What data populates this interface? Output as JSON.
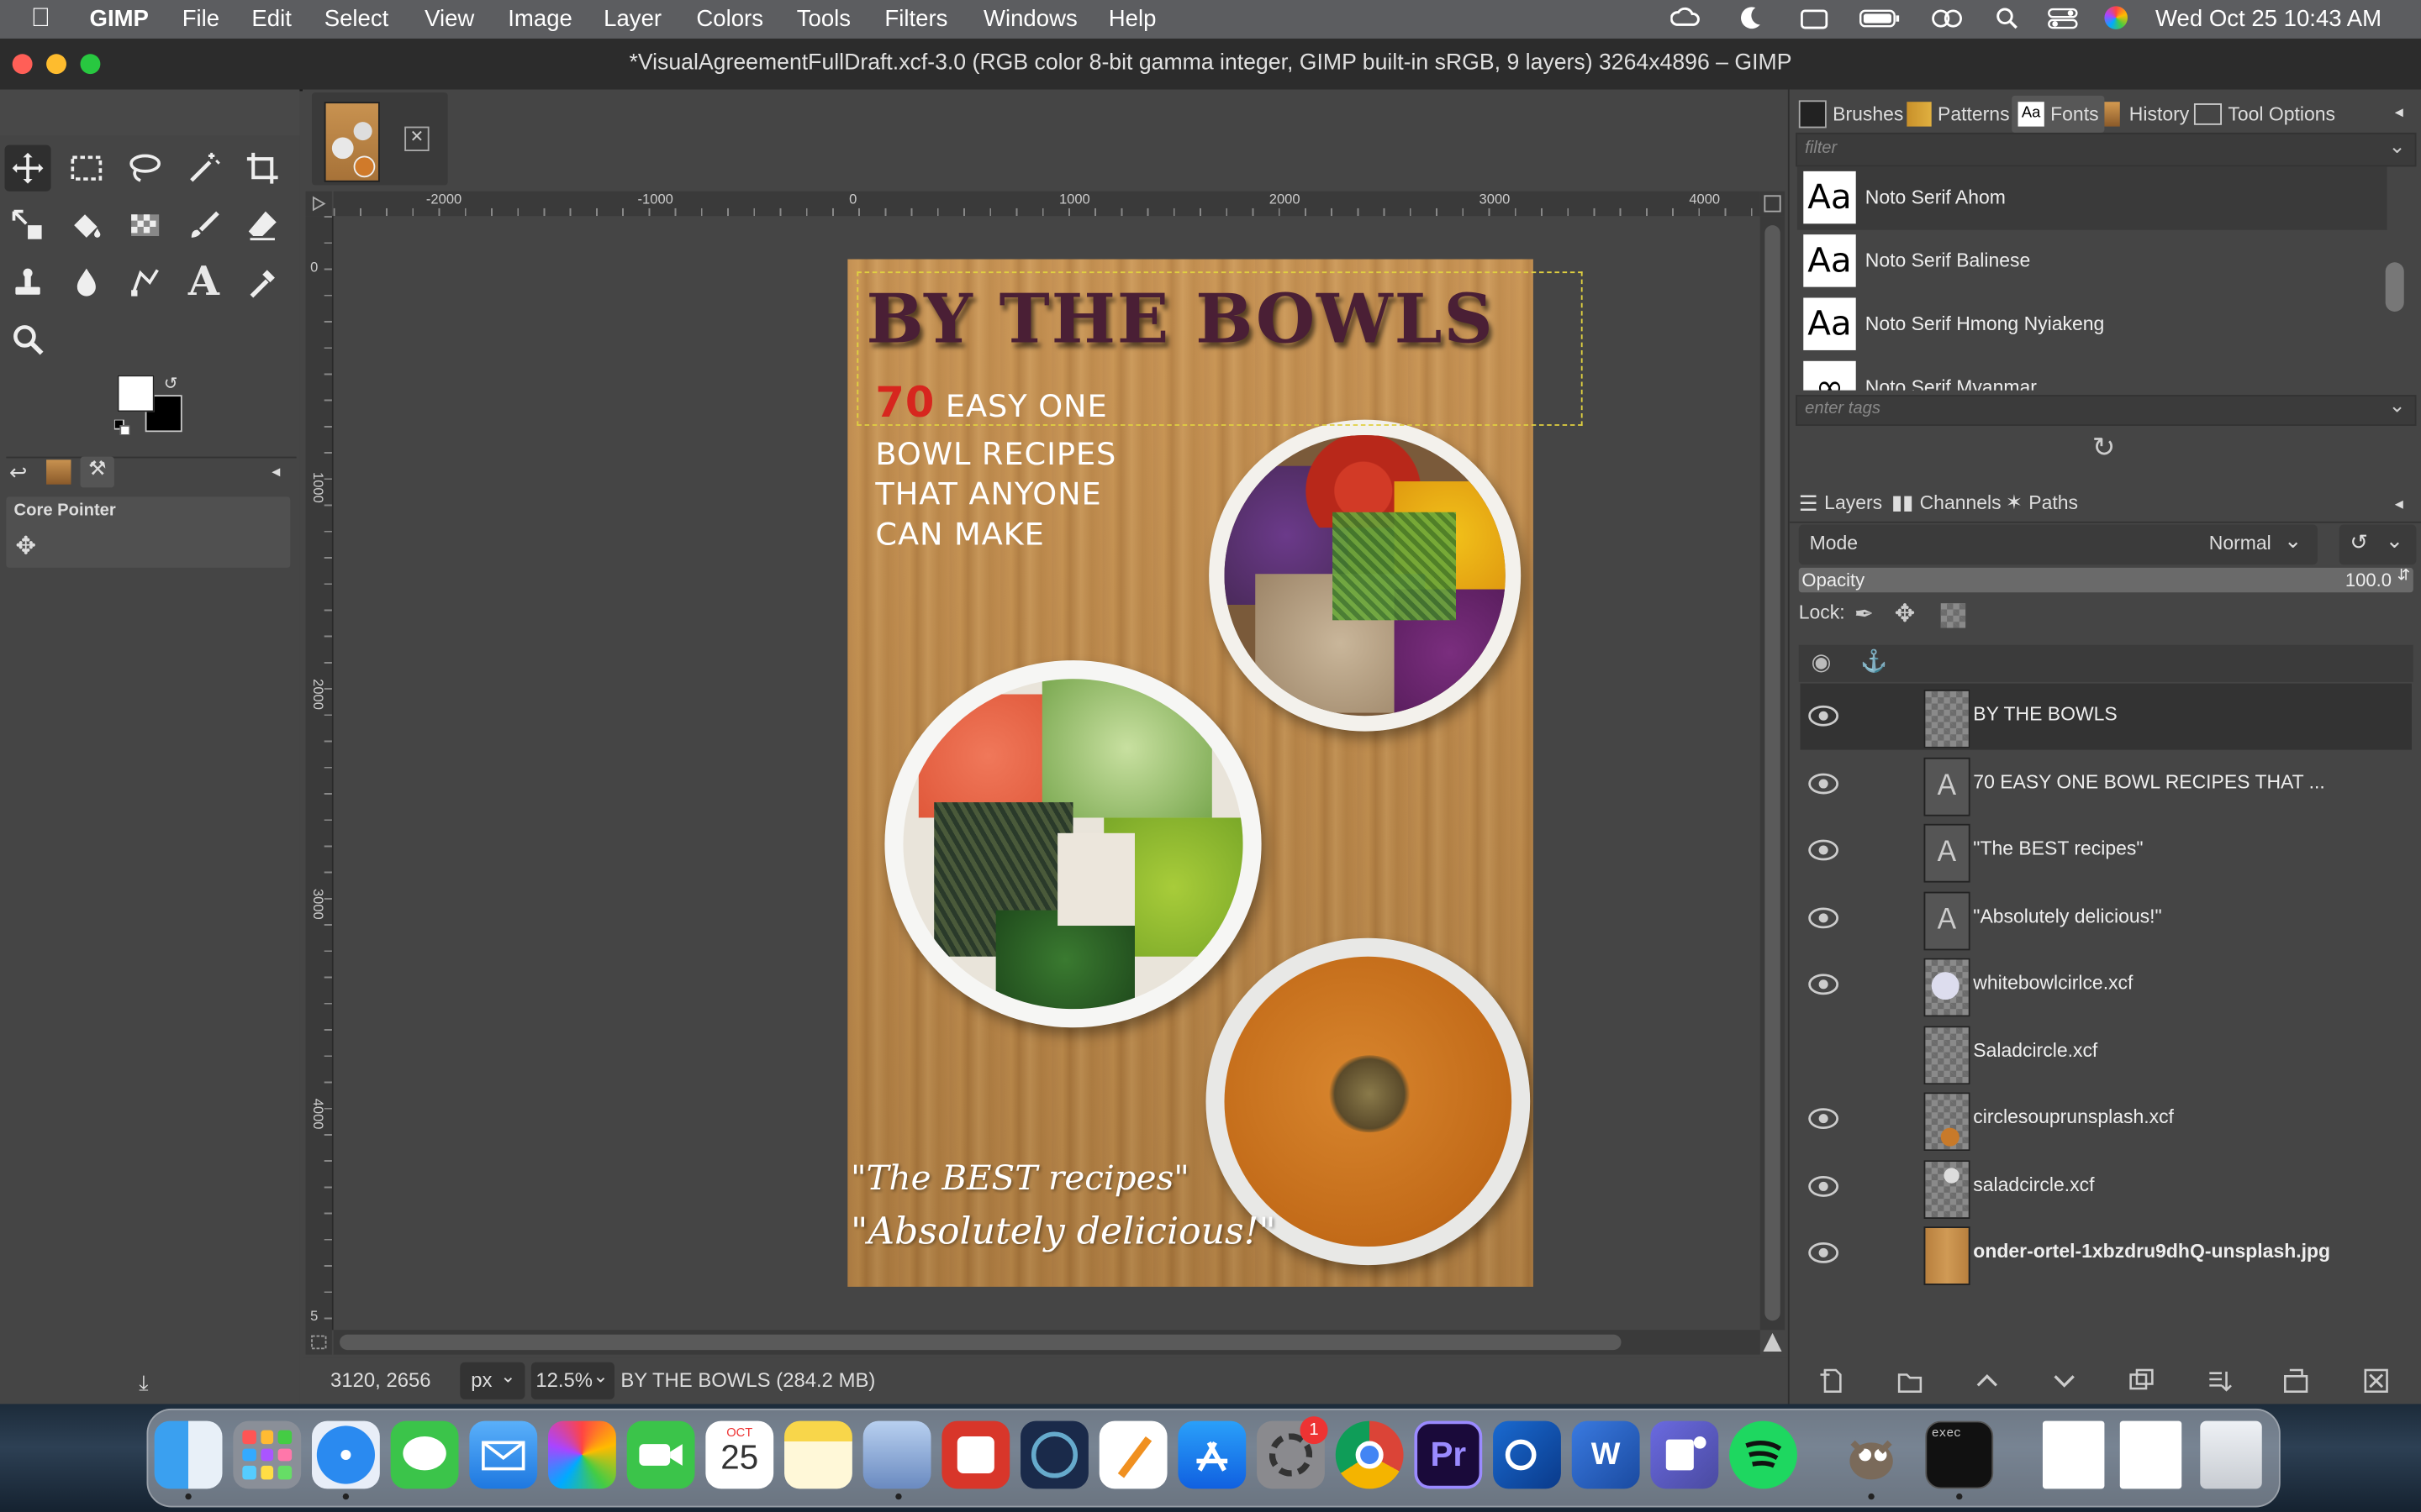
{
  "menubar": {
    "apple": "",
    "app_name": "GIMP",
    "items": [
      "File",
      "Edit",
      "Select",
      "View",
      "Image",
      "Layer",
      "Colors",
      "Tools",
      "Filters",
      "Windows",
      "Help"
    ],
    "datetime": "Wed Oct 25  10:43 AM"
  },
  "window": {
    "title": "*VisualAgreementFullDraft.xcf-3.0 (RGB color 8-bit gamma integer, GIMP built-in sRGB, 9 layers) 3264x4896 – GIMP"
  },
  "toolbox": {
    "tools": [
      "move-tool",
      "rect-select-tool",
      "free-select-tool",
      "fuzzy-select-tool",
      "crop-tool",
      "unified-transform-tool",
      "bucket-fill-tool",
      "gradient-tool",
      "paintbrush-tool",
      "eraser-tool",
      "clone-tool",
      "smudge-tool",
      "measure-tool",
      "text-tool",
      "color-picker-tool",
      "zoom-tool"
    ],
    "tool_options_title": "Core Pointer",
    "fg_color": "#ffffff",
    "bg_color": "#000000"
  },
  "ruler": {
    "top_labels": [
      "-2000",
      "-1000",
      "0",
      "1000",
      "2000",
      "3000",
      "4000"
    ],
    "left_labels": [
      "0",
      "1000",
      "2000",
      "3000",
      "4000",
      "5"
    ]
  },
  "poster": {
    "title": "BY THE BOWLS",
    "subtitle_number": "70",
    "subtitle_line1": "EASY ONE",
    "subtitle_line2": "BOWL RECIPES",
    "subtitle_line3": "THAT ANYONE",
    "subtitle_line4": "CAN MAKE",
    "quote1": "\"The BEST recipes\"",
    "quote2": "\"Absolutely delicious!\"",
    "title_color": "#4a1f35",
    "number_color": "#d7261e"
  },
  "status": {
    "coords": "3120, 2656",
    "unit": "px",
    "zoom": "12.5%",
    "info": "BY THE BOWLS (284.2 MB)"
  },
  "dock_top": {
    "tabs": [
      "Brushes",
      "Patterns",
      "Fonts",
      "History",
      "Tool Options"
    ],
    "filter_placeholder": "filter",
    "tags_placeholder": "enter tags",
    "fonts": [
      "Noto Serif Ahom",
      "Noto Serif Balinese",
      "Noto Serif Hmong Nyiakeng",
      "Noto Serif Myanmar"
    ],
    "font_sample": "Aa"
  },
  "dock_layers": {
    "tabs": [
      "Layers",
      "Channels",
      "Paths"
    ],
    "mode_label": "Mode",
    "mode_value": "Normal",
    "opacity_label": "Opacity",
    "opacity_value": "100.0",
    "lock_label": "Lock:",
    "layers": [
      {
        "name": "BY THE BOWLS",
        "visible": true,
        "kind": "checker"
      },
      {
        "name": "70 EASY ONE BOWL RECIPES THAT ...",
        "visible": true,
        "kind": "text"
      },
      {
        "name": "\"The BEST recipes\"",
        "visible": true,
        "kind": "text"
      },
      {
        "name": "\"Absolutely delicious!\"",
        "visible": true,
        "kind": "text"
      },
      {
        "name": "whitebowlcirlce.xcf",
        "visible": true,
        "kind": "checker"
      },
      {
        "name": "Saladcircle.xcf",
        "visible": false,
        "kind": "checker"
      },
      {
        "name": "circlesouprunsplash.xcf",
        "visible": true,
        "kind": "checker"
      },
      {
        "name": "saladcircle.xcf",
        "visible": true,
        "kind": "checker"
      },
      {
        "name": "onder-ortel-1xbzdru9dhQ-unsplash.jpg",
        "visible": true,
        "kind": "wood"
      }
    ]
  },
  "dock_apps": {
    "calendar_month": "OCT",
    "calendar_day": "25",
    "settings_badge": "1",
    "premiere_label": "Pr",
    "terminal_label": "exec"
  }
}
